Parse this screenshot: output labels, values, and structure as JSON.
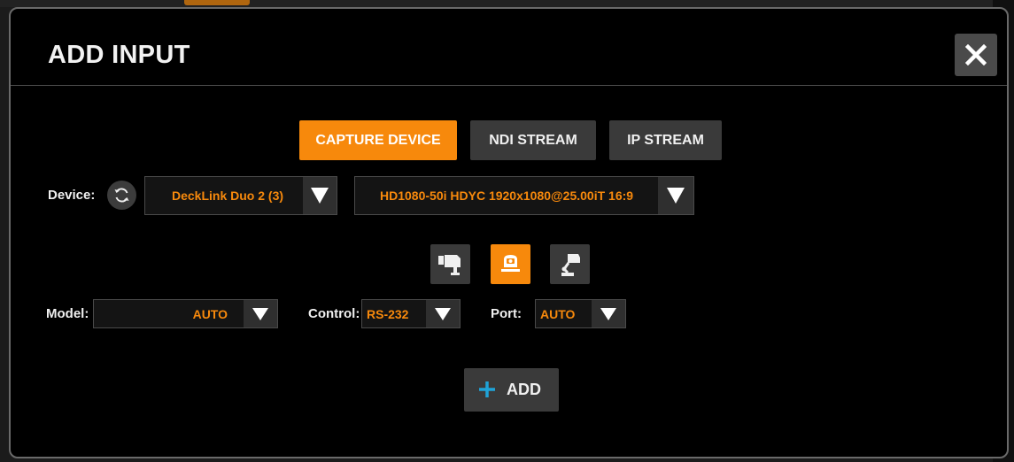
{
  "dialog": {
    "title": "ADD INPUT",
    "close_icon": "close-icon"
  },
  "source_tabs": [
    {
      "label": "CAPTURE DEVICE",
      "active": true
    },
    {
      "label": "NDI STREAM",
      "active": false
    },
    {
      "label": "IP STREAM",
      "active": false
    }
  ],
  "device": {
    "label": "Device:",
    "refresh_icon": "refresh-icon",
    "selected_device": "DeckLink Duo 2 (3)",
    "selected_format": "HD1080-50i HDYC 1920x1080@25.00iT 16:9"
  },
  "camera_types": [
    {
      "icon": "fixed-camera-icon",
      "active": false
    },
    {
      "icon": "ptz-camera-icon",
      "active": true
    },
    {
      "icon": "robotic-camera-icon",
      "active": false
    }
  ],
  "model": {
    "label": "Model:",
    "value": "AUTO"
  },
  "control": {
    "label": "Control:",
    "value": "RS-232"
  },
  "port": {
    "label": "Port:",
    "value": "AUTO"
  },
  "add_button": {
    "label": "ADD",
    "icon": "plus-icon"
  },
  "colors": {
    "accent": "#f7890c",
    "plus": "#1fa3d8",
    "button": "#3a3a3a",
    "background": "#000000"
  }
}
